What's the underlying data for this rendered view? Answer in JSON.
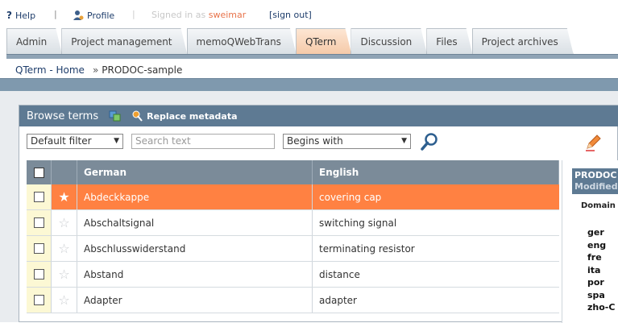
{
  "topbar": {
    "help": "Help",
    "profile": "Profile",
    "signed_in_prefix": "Signed in as",
    "username": "sweimar",
    "sign_out": "[sign out]"
  },
  "tabs": [
    {
      "label": "Admin"
    },
    {
      "label": "Project management"
    },
    {
      "label": "memoQWebTrans"
    },
    {
      "label": "QTerm",
      "active": true
    },
    {
      "label": "Discussion"
    },
    {
      "label": "Files"
    },
    {
      "label": "Project archives"
    }
  ],
  "breadcrumb": {
    "home": "QTerm - Home",
    "separator": "»",
    "current": "PRODOC-sample"
  },
  "browse": {
    "title": "Browse terms",
    "replace_metadata": "Replace metadata",
    "filter_value": "Default filter",
    "search_placeholder": "Search text",
    "match_mode": "Begins with"
  },
  "table": {
    "headers": {
      "col1": "German",
      "col2": "English"
    },
    "rows": [
      {
        "de": "Abdeckkappe",
        "en": "covering cap",
        "selected": true
      },
      {
        "de": "Abschaltsignal",
        "en": "switching signal"
      },
      {
        "de": "Abschlusswiderstand",
        "en": "terminating resistor"
      },
      {
        "de": "Abstand",
        "en": "distance"
      },
      {
        "de": "Adapter",
        "en": "adapter"
      }
    ]
  },
  "meta": {
    "head_line1": "PRODOC",
    "head_line2": "Modified",
    "domain_label": "Domain",
    "languages": [
      "ger",
      "eng",
      "fre",
      "ita",
      "por",
      "spa",
      "zho-C"
    ]
  },
  "colors": {
    "accent_orange": "#ff8142",
    "header_blue": "#5e7a93",
    "table_header": "#7b8b99",
    "checkbox_column": "#fcf8d4"
  }
}
